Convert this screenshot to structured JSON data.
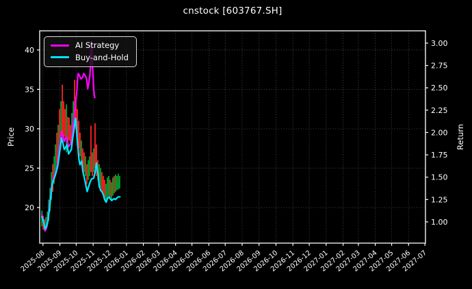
{
  "window": {
    "title": "cnstock [603767.SH]"
  },
  "colors": {
    "background": "#000000",
    "text": "#ffffff",
    "grid": "#5c5c5c",
    "spine": "#ffffff",
    "ai_strategy": "#ff00ff",
    "buy_and_hold": "#00e5ff",
    "candle_up": "#00a42e",
    "candle_down": "#ff2424"
  },
  "legend": {
    "items": [
      {
        "label": "AI Strategy",
        "color": "#ff00ff"
      },
      {
        "label": "Buy-and-Hold",
        "color": "#00e5ff"
      }
    ]
  },
  "chart_data": {
    "type": "line",
    "title": "cnstock [603767.SH]",
    "grid": true,
    "legend_position": "upper left",
    "x_axis": {
      "unit": "days (day 0 = 2025-07-26)",
      "range": [
        0,
        707
      ],
      "tick_days": [
        6,
        37,
        67,
        98,
        128,
        159,
        190,
        218,
        249,
        279,
        310,
        340,
        371,
        402,
        433,
        464,
        494,
        525,
        556,
        584,
        615,
        645,
        676,
        706
      ],
      "tick_labels": [
        "2025-08",
        "2025-09",
        "2025-10",
        "2025-11",
        "2025-12",
        "2026-01",
        "2026-02",
        "2026-03",
        "2026-04",
        "2026-05",
        "2026-06",
        "2026-07",
        "2026-08",
        "2026-09",
        "2026-10",
        "2026-11",
        "2026-12",
        "2027-01",
        "2027-02",
        "2027-03",
        "2027-04",
        "2027-05",
        "2027-06",
        "2027-07"
      ]
    },
    "left_axis": {
      "label": "Price",
      "range": [
        15.48,
        42.43
      ],
      "ticks": [
        20,
        25,
        30,
        35,
        40
      ]
    },
    "right_axis": {
      "label": "Return",
      "range": [
        0.7625,
        3.1375
      ],
      "ticks": [
        "1.00",
        "1.25",
        "1.50",
        "1.75",
        "2.00",
        "2.25",
        "2.50",
        "2.75",
        "3.00"
      ]
    },
    "series": [
      {
        "name": "AI Strategy",
        "axis": "return",
        "color": "#ff00ff",
        "points": [
          [
            4,
            1.08
          ],
          [
            7,
            1.02
          ],
          [
            10,
            0.9
          ],
          [
            13,
            0.94
          ],
          [
            15,
            1.03
          ],
          [
            18,
            1.18
          ],
          [
            20,
            1.3
          ],
          [
            23,
            1.44
          ],
          [
            25,
            1.48
          ],
          [
            28,
            1.53
          ],
          [
            30,
            1.58
          ],
          [
            33,
            1.66
          ],
          [
            35,
            1.78
          ],
          [
            38,
            1.91
          ],
          [
            40,
            2.01
          ],
          [
            43,
            1.95
          ],
          [
            45,
            1.9
          ],
          [
            48,
            1.95
          ],
          [
            50,
            1.93
          ],
          [
            53,
            1.84
          ],
          [
            55,
            1.86
          ],
          [
            58,
            1.88
          ],
          [
            60,
            2.03
          ],
          [
            63,
            2.18
          ],
          [
            65,
            2.3
          ],
          [
            68,
            2.45
          ],
          [
            70,
            2.64
          ],
          [
            71,
            2.66
          ],
          [
            74,
            2.62
          ],
          [
            76,
            2.6
          ],
          [
            79,
            2.62
          ],
          [
            81,
            2.66
          ],
          [
            84,
            2.63
          ],
          [
            86,
            2.6
          ],
          [
            87,
            2.55
          ],
          [
            88,
            2.49
          ],
          [
            90,
            2.55
          ],
          [
            92,
            2.64
          ],
          [
            93,
            2.72
          ],
          [
            94,
            3.01
          ],
          [
            95,
            3.02
          ],
          [
            96,
            2.83
          ],
          [
            98,
            2.62
          ],
          [
            99,
            2.48
          ],
          [
            100,
            2.42
          ],
          [
            101,
            2.39
          ]
        ]
      },
      {
        "name": "Buy-and-Hold",
        "axis": "return",
        "color": "#00e5ff",
        "points": [
          [
            4,
            1.06
          ],
          [
            7,
            1.0
          ],
          [
            10,
            0.92
          ],
          [
            13,
            0.96
          ],
          [
            15,
            1.01
          ],
          [
            18,
            1.15
          ],
          [
            20,
            1.27
          ],
          [
            23,
            1.42
          ],
          [
            25,
            1.46
          ],
          [
            28,
            1.51
          ],
          [
            30,
            1.55
          ],
          [
            33,
            1.62
          ],
          [
            35,
            1.71
          ],
          [
            38,
            1.84
          ],
          [
            40,
            1.94
          ],
          [
            43,
            1.87
          ],
          [
            45,
            1.81
          ],
          [
            48,
            1.84
          ],
          [
            50,
            1.86
          ],
          [
            53,
            1.76
          ],
          [
            55,
            1.78
          ],
          [
            58,
            1.81
          ],
          [
            60,
            1.92
          ],
          [
            63,
            2.04
          ],
          [
            65,
            2.14
          ],
          [
            66,
            2.16
          ],
          [
            69,
            1.91
          ],
          [
            72,
            1.7
          ],
          [
            74,
            1.64
          ],
          [
            77,
            1.68
          ],
          [
            79,
            1.57
          ],
          [
            82,
            1.49
          ],
          [
            84,
            1.43
          ],
          [
            87,
            1.34
          ],
          [
            89,
            1.38
          ],
          [
            92,
            1.44
          ],
          [
            95,
            1.48
          ],
          [
            99,
            1.49
          ],
          [
            102,
            1.57
          ],
          [
            104,
            1.66
          ],
          [
            107,
            1.53
          ],
          [
            109,
            1.4
          ],
          [
            112,
            1.35
          ],
          [
            114,
            1.34
          ],
          [
            117,
            1.3
          ],
          [
            119,
            1.25
          ],
          [
            122,
            1.22
          ],
          [
            124,
            1.26
          ],
          [
            127,
            1.28
          ],
          [
            129,
            1.26
          ],
          [
            132,
            1.24
          ],
          [
            134,
            1.25
          ],
          [
            137,
            1.26
          ],
          [
            139,
            1.25
          ],
          [
            142,
            1.27
          ],
          [
            144,
            1.28
          ],
          [
            147,
            1.28
          ]
        ]
      }
    ],
    "candles": {
      "axis": "price",
      "up_color": "#00a42e",
      "down_color": "#ff2424",
      "bars": [
        [
          4,
          17.6,
          19.6,
          "u"
        ],
        [
          6.5,
          17.2,
          18.9,
          "d"
        ],
        [
          9,
          17.0,
          18.5,
          "d"
        ],
        [
          11.5,
          17.3,
          18.8,
          "u"
        ],
        [
          14,
          17.8,
          19.5,
          "u"
        ],
        [
          16.5,
          18.3,
          21.0,
          "u"
        ],
        [
          19,
          19.5,
          22.5,
          "u"
        ],
        [
          21.5,
          21.0,
          24.5,
          "u"
        ],
        [
          24,
          22.0,
          25.5,
          "d"
        ],
        [
          26.5,
          23.0,
          26.5,
          "u"
        ],
        [
          29,
          24.0,
          28.0,
          "u"
        ],
        [
          31.5,
          25.5,
          29.5,
          "d"
        ],
        [
          34,
          26.0,
          30.5,
          "u"
        ],
        [
          36.5,
          27.5,
          32.5,
          "d"
        ],
        [
          39,
          28.5,
          33.5,
          "u"
        ],
        [
          41.5,
          29.0,
          35.6,
          "d"
        ],
        [
          44,
          28.5,
          33.5,
          "d"
        ],
        [
          46.5,
          29.0,
          32.5,
          "d"
        ],
        [
          49,
          27.0,
          33.1,
          "u"
        ],
        [
          51.5,
          28.0,
          31.5,
          "d"
        ],
        [
          54,
          28.5,
          31.4,
          "d"
        ],
        [
          56.5,
          28.0,
          30.5,
          "d"
        ],
        [
          59,
          29.0,
          32.0,
          "u"
        ],
        [
          61.5,
          30.0,
          33.5,
          "u"
        ],
        [
          64,
          30.5,
          36.2,
          "d"
        ],
        [
          66.5,
          30.0,
          34.0,
          "d"
        ],
        [
          69,
          29.0,
          32.5,
          "d"
        ],
        [
          71.5,
          27.5,
          31.0,
          "d"
        ],
        [
          74,
          26.5,
          29.5,
          "d"
        ],
        [
          76.5,
          26.0,
          28.5,
          "u"
        ],
        [
          79,
          25.0,
          27.5,
          "d"
        ],
        [
          81.5,
          24.5,
          27.0,
          "d"
        ],
        [
          84,
          24.0,
          26.5,
          "u"
        ],
        [
          86.5,
          23.0,
          25.5,
          "d"
        ],
        [
          89,
          23.5,
          26.0,
          "u"
        ],
        [
          91.5,
          24.0,
          26.5,
          "u"
        ],
        [
          94,
          24.5,
          30.4,
          "d"
        ],
        [
          96.5,
          24.0,
          27.0,
          "d"
        ],
        [
          99,
          24.5,
          27.5,
          "u"
        ],
        [
          101.5,
          25.0,
          30.7,
          "d"
        ],
        [
          104,
          24.0,
          28.0,
          "d"
        ],
        [
          106.5,
          23.5,
          26.0,
          "d"
        ],
        [
          109,
          23.0,
          25.5,
          "u"
        ],
        [
          111.5,
          22.5,
          25.0,
          "u"
        ],
        [
          114,
          22.0,
          24.5,
          "d"
        ],
        [
          116.5,
          21.5,
          24.0,
          "d"
        ],
        [
          119,
          21.2,
          23.5,
          "d"
        ],
        [
          121.5,
          20.9,
          23.0,
          "u"
        ],
        [
          124,
          21.2,
          23.8,
          "u"
        ],
        [
          126.5,
          21.5,
          24.0,
          "u"
        ],
        [
          129,
          21.3,
          23.5,
          "d"
        ],
        [
          131.5,
          21.0,
          23.2,
          "u"
        ],
        [
          134,
          21.5,
          23.8,
          "u"
        ],
        [
          136.5,
          21.8,
          24.0,
          "d"
        ],
        [
          139,
          22.0,
          24.2,
          "u"
        ],
        [
          141.5,
          22.2,
          24.0,
          "u"
        ],
        [
          144,
          22.3,
          24.3,
          "u"
        ],
        [
          146.5,
          22.4,
          24.0,
          "u"
        ]
      ]
    }
  }
}
